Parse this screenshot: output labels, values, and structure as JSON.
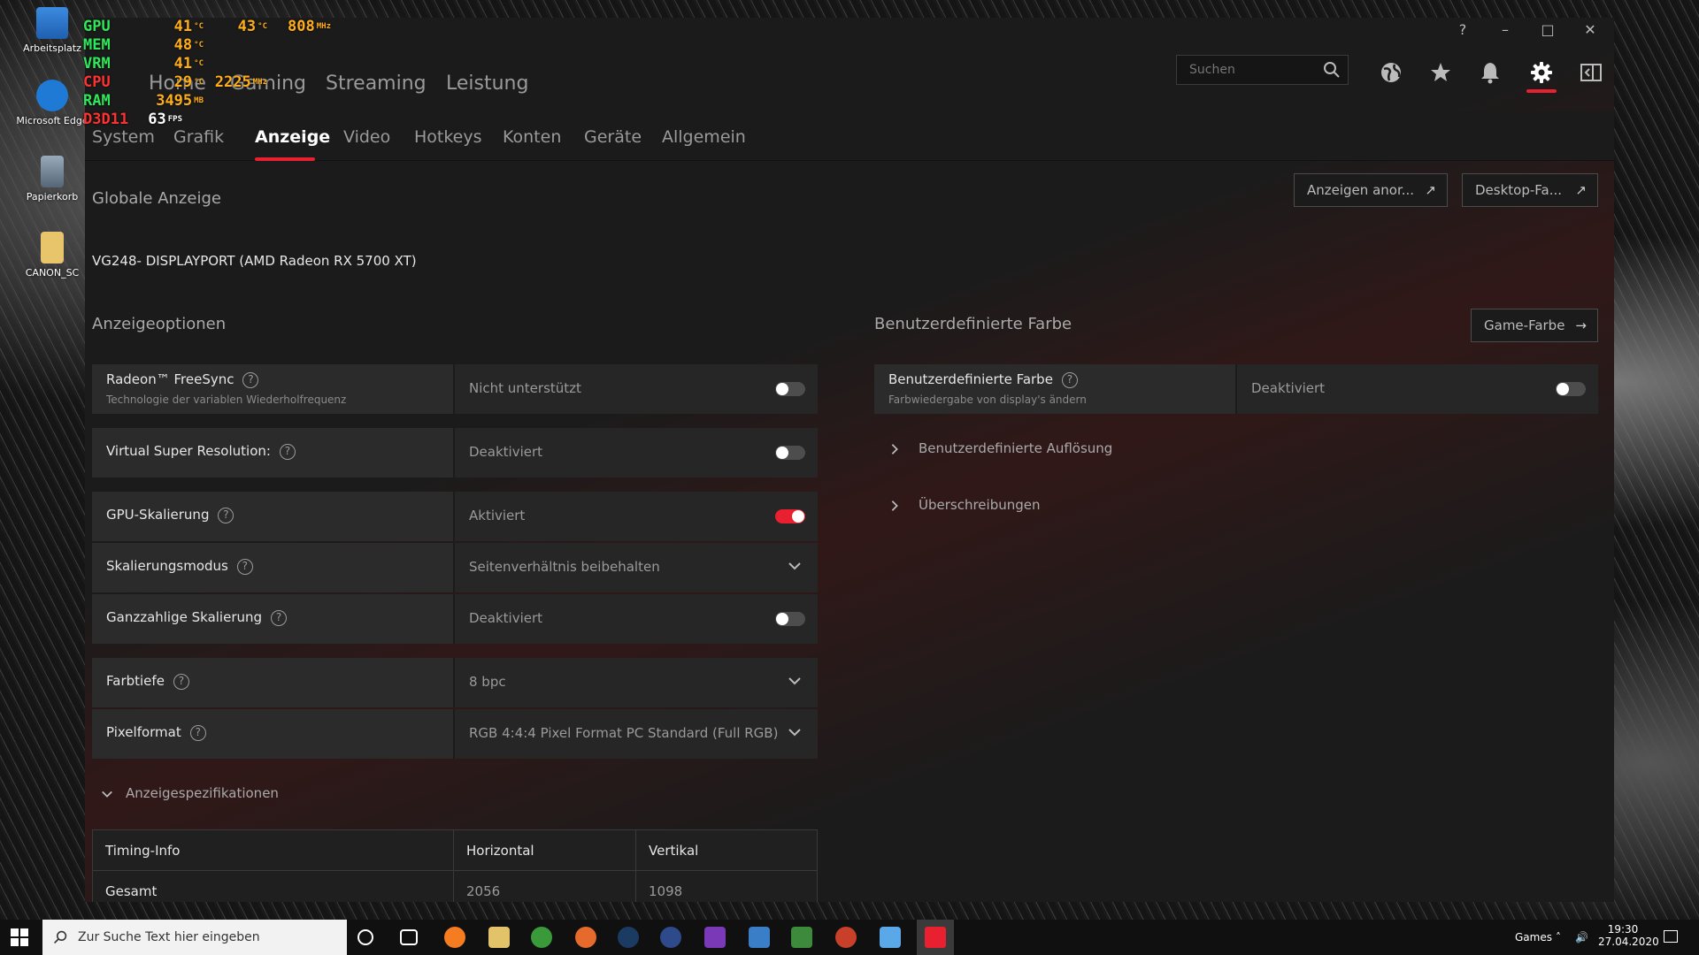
{
  "desktop": {
    "icons": [
      {
        "label": "Arbeitsplatz"
      },
      {
        "label": "Microsoft Edge"
      },
      {
        "label": "Papierkorb"
      },
      {
        "label": "CANON_SC"
      }
    ]
  },
  "osd": [
    {
      "label": "GPU",
      "v1": "41",
      "u1": "°C",
      "v2": "43",
      "u2": "°C",
      "v3": "808",
      "u3": "MHz"
    },
    {
      "label": "MEM",
      "v1": "48",
      "u1": "°C"
    },
    {
      "label": "VRM",
      "v1": "41",
      "u1": "°C"
    },
    {
      "label": "CPU",
      "v1": "29",
      "u1": "°C",
      "v2": "2225",
      "u2": "MHz"
    },
    {
      "label": "RAM",
      "v1": "3495",
      "u1": "MB"
    },
    {
      "label": "D3D11",
      "v1": "63",
      "u1": "FPS"
    }
  ],
  "main_tabs": [
    "Home",
    "Gaming",
    "Streaming",
    "Leistung"
  ],
  "search": {
    "placeholder": "Suchen"
  },
  "sub_tabs": [
    "System",
    "Grafik",
    "Anzeige",
    "Video",
    "Hotkeys",
    "Konten",
    "Geräte",
    "Allgemein"
  ],
  "global": {
    "title": "Globale Anzeige",
    "btn_arrange": "Anzeigen anor...",
    "btn_desktop": "Desktop-Fa...",
    "display_name": "VG248- DISPLAYPORT (AMD Radeon RX 5700 XT)"
  },
  "options": {
    "title": "Anzeigeoptionen",
    "rows": [
      {
        "label": "Radeon™ FreeSync",
        "sub": "Technologie der variablen Wiederholfrequenz",
        "value": "Nicht unterstützt",
        "on": false
      },
      {
        "label": "Virtual Super Resolution:",
        "value": "Deaktiviert",
        "on": false
      },
      {
        "label": "GPU-Skalierung",
        "value": "Aktiviert",
        "on": true
      },
      {
        "label": "Skalierungsmodus",
        "value": "Seitenverhältnis beibehalten"
      },
      {
        "label": "Ganzzahlige Skalierung",
        "value": "Deaktiviert",
        "on": false
      },
      {
        "label": "Farbtiefe",
        "value": "8 bpc"
      },
      {
        "label": "Pixelformat",
        "value": "RGB 4:4:4 Pixel Format PC Standard (Full RGB)"
      }
    ],
    "specs_label": "Anzeigespezifikationen"
  },
  "spec_table": {
    "headers": [
      "Timing-Info",
      "Horizontal",
      "Vertikal"
    ],
    "rows": [
      [
        "Gesamt",
        "2056",
        "1098"
      ]
    ]
  },
  "custom_color": {
    "title": "Benutzerdefinierte Farbe",
    "game_btn": "Game-Farbe",
    "row_label": "Benutzerdefinierte Farbe",
    "row_sub": "Farbwiedergabe von display's ändern",
    "row_value": "Deaktiviert",
    "expand1": "Benutzerdefinierte Auflösung",
    "expand2": "Überschreibungen"
  },
  "taskbar": {
    "search_placeholder": "Zur Suche Text hier eingeben",
    "tray_label": "Games",
    "time": "19:30",
    "date": "27.04.2020"
  },
  "colors": {
    "accent": "#e8202f",
    "osd_green": "#2ee85a",
    "osd_orange": "#ffae1a"
  }
}
